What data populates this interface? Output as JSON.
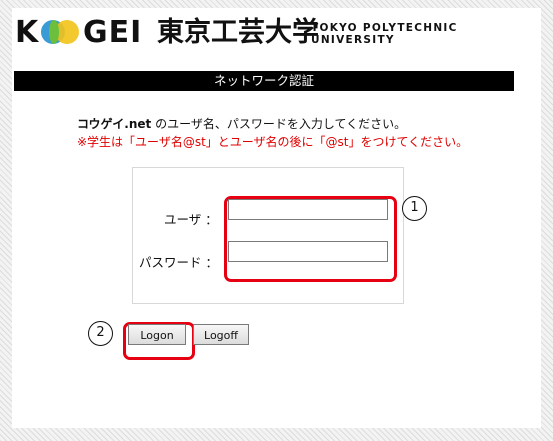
{
  "logo": {
    "latin_k": "K",
    "latin_gei": "GEI",
    "japanese": "東京工芸大学",
    "english_line1": "TOKYO POLYTECHNIC",
    "english_line2": "UNIVERSITY"
  },
  "header": {
    "title": "ネットワーク認証"
  },
  "instructions": {
    "brand": "コウゲイ.net",
    "line1_rest": " のユーザ名、パスワードを入力してください。",
    "line2": "※学生は「ユーザ名@st」とユーザ名の後に「@st」をつけてください。"
  },
  "form": {
    "username_label": "ユーザ ：",
    "username_value": "",
    "password_label": "パスワード ：",
    "password_value": ""
  },
  "markers": {
    "one": "1",
    "two": "2"
  },
  "buttons": {
    "logon": "Logon",
    "logoff": "Logoff"
  },
  "colors": {
    "highlight": "#e60012",
    "notice_text": "#e00000",
    "header_bg": "#000000"
  }
}
